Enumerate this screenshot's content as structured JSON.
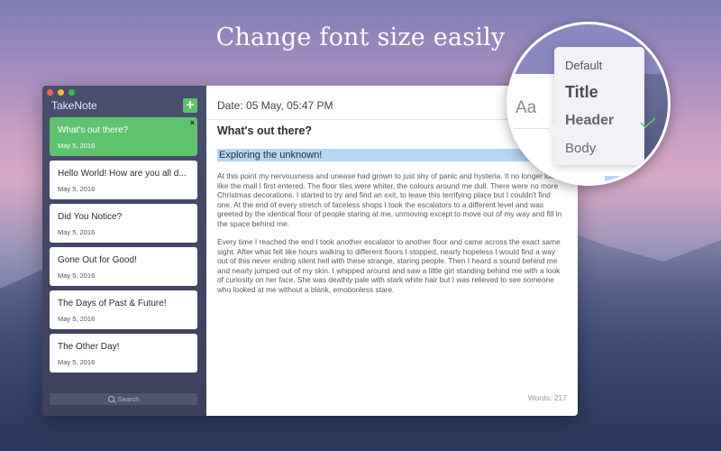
{
  "headline": "Change font size easily",
  "app": {
    "title": "TakeNote",
    "add_label": "+",
    "search_placeholder": "Search"
  },
  "notes": [
    {
      "title": "What's out there?",
      "date": "May 5, 2016",
      "active": true
    },
    {
      "title": "Hello World! How are you all d...",
      "date": "May 5, 2016"
    },
    {
      "title": "Did You Notice?",
      "date": "May 5, 2016"
    },
    {
      "title": "Gone Out for Good!",
      "date": "May 5, 2016"
    },
    {
      "title": "The Days of Past & Future!",
      "date": "May 5, 2016"
    },
    {
      "title": "The Other Day!",
      "date": "May 5, 2016"
    }
  ],
  "close_label": "×",
  "editor": {
    "date_line": "Date: 05 May, 05:47 PM",
    "font_button": "Aa",
    "heading": "What's out there?",
    "selected_text": "Exploring the unknown!",
    "paragraph_1": "At this point my nervousness and unease had grown to just shy of panic and hysteria. It no longer looked like the mall I first entered. The floor tiles were whiter, the colours around me dull. There were no more Christmas decorations. I started to try and find an exit, to leave this terrifying place but I couldn't find one. At the end of every stretch of faceless shops I took the escalators to a different level and was greeted by the identical floor of people staring at me, unmoving except to move out of my way and fill in the space behind me.",
    "paragraph_2": "Every time I reached the end I took another escalator to another floor and came across the exact same sight. After what felt like hours walking to different floors I stopped, nearly hopeless I would find a way out of this never ending silent hell with these strange, staring people. Then I heard a sound behind me and nearly jumped out of my skin. I whipped around and saw a little girl standing behind me with a look of curiosity on her face. She was deathly pale with stark white hair but I was relieved to see someone who looked at me without a blank, emotionless stare.",
    "word_count": "Words: 217"
  },
  "font_menu": {
    "options": [
      "Default",
      "Title",
      "Header",
      "Body"
    ],
    "selected": "Header"
  },
  "colors": {
    "accent_green": "#5fc26f",
    "selection_blue": "#b6d5f3"
  }
}
